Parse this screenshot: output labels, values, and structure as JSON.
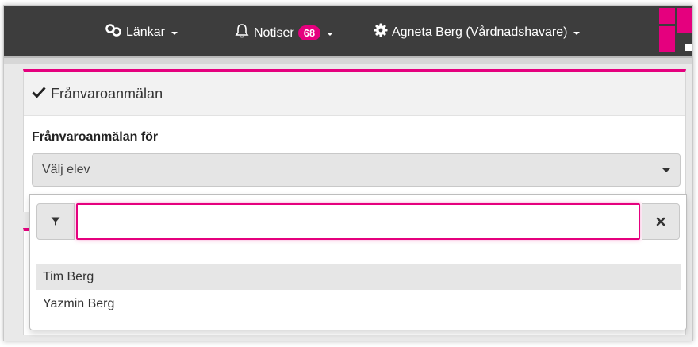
{
  "topbar": {
    "links_label": "Länkar",
    "notices_label": "Notiser",
    "notices_count": "68",
    "user_label": "Agneta Berg (Vårdnadshavare)"
  },
  "brand_color": "#e5007e",
  "panel": {
    "title": "Frånvaroanmälan",
    "field_label": "Frånvaroanmälan för",
    "select_value": "Välj elev"
  },
  "dropdown": {
    "filter_value": "",
    "options": [
      "Tim Berg",
      "Yazmin Berg"
    ],
    "highlighted_index": 0
  },
  "icons": {
    "links": "link-icon",
    "notices": "bell-icon",
    "user": "gear-icon",
    "title": "check-icon",
    "filter": "filter-icon",
    "clear": "close-icon"
  }
}
